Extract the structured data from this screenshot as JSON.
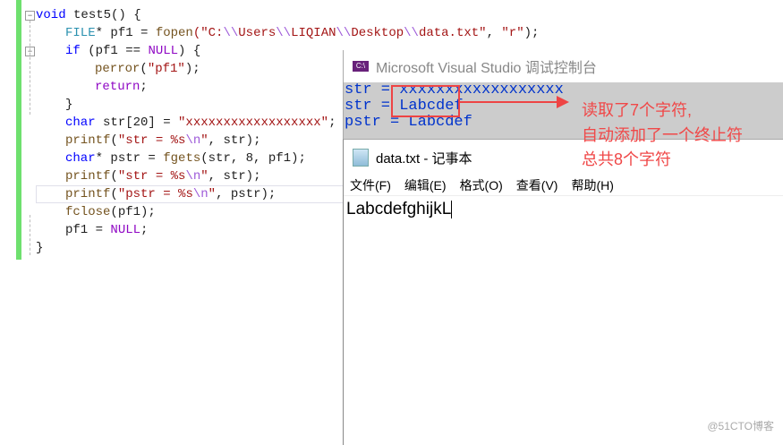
{
  "code": {
    "lines": [
      [
        "void",
        " test5() {"
      ],
      [
        "FILE",
        "* pf1 = ",
        "fopen",
        "(\"C:",
        "\\\\",
        "Users",
        "\\\\",
        "LIQIAN",
        "\\\\",
        "Desktop",
        "\\\\",
        "data.txt\"",
        ", ",
        "\"r\"",
        ");"
      ],
      [
        "if",
        " (pf1 == ",
        "NULL",
        ") {"
      ],
      [
        "perror",
        "(",
        "\"pf1\"",
        ");"
      ],
      [
        "return",
        ";"
      ],
      [
        "}"
      ],
      [
        "char",
        " str[20] = ",
        "\"xxxxxxxxxxxxxxxxxx\"",
        ";"
      ],
      [
        "printf",
        "(",
        "\"str = %s",
        "\\n",
        "\"",
        ", str);"
      ],
      [
        "char",
        "* pstr = ",
        "fgets",
        "(str, 8, pf1);"
      ],
      [
        "printf",
        "(",
        "\"str = %s",
        "\\n",
        "\"",
        ", str);"
      ],
      [
        "printf",
        "(",
        "\"pstr = %s",
        "\\n",
        "\"",
        ", pstr);"
      ],
      [
        "fclose",
        "(pf1);"
      ],
      [
        "pf1 = ",
        "NULL",
        ";"
      ],
      [
        "}"
      ]
    ]
  },
  "console": {
    "icon": "C:\\",
    "title": "Microsoft Visual Studio 调试控制台",
    "lines": [
      "str = xxxxxxxxxxxxxxxxxx",
      "str = Labcdef",
      "pstr = Labcdef"
    ]
  },
  "notepad": {
    "title": "data.txt - 记事本",
    "menu": [
      "文件(F)",
      "编辑(E)",
      "格式(O)",
      "查看(V)",
      "帮助(H)"
    ],
    "content": "LabcdefghijkL"
  },
  "annotation": [
    "读取了7个字符,",
    "自动添加了一个终止符",
    "总共8个字符"
  ],
  "watermark": "@51CTO博客"
}
